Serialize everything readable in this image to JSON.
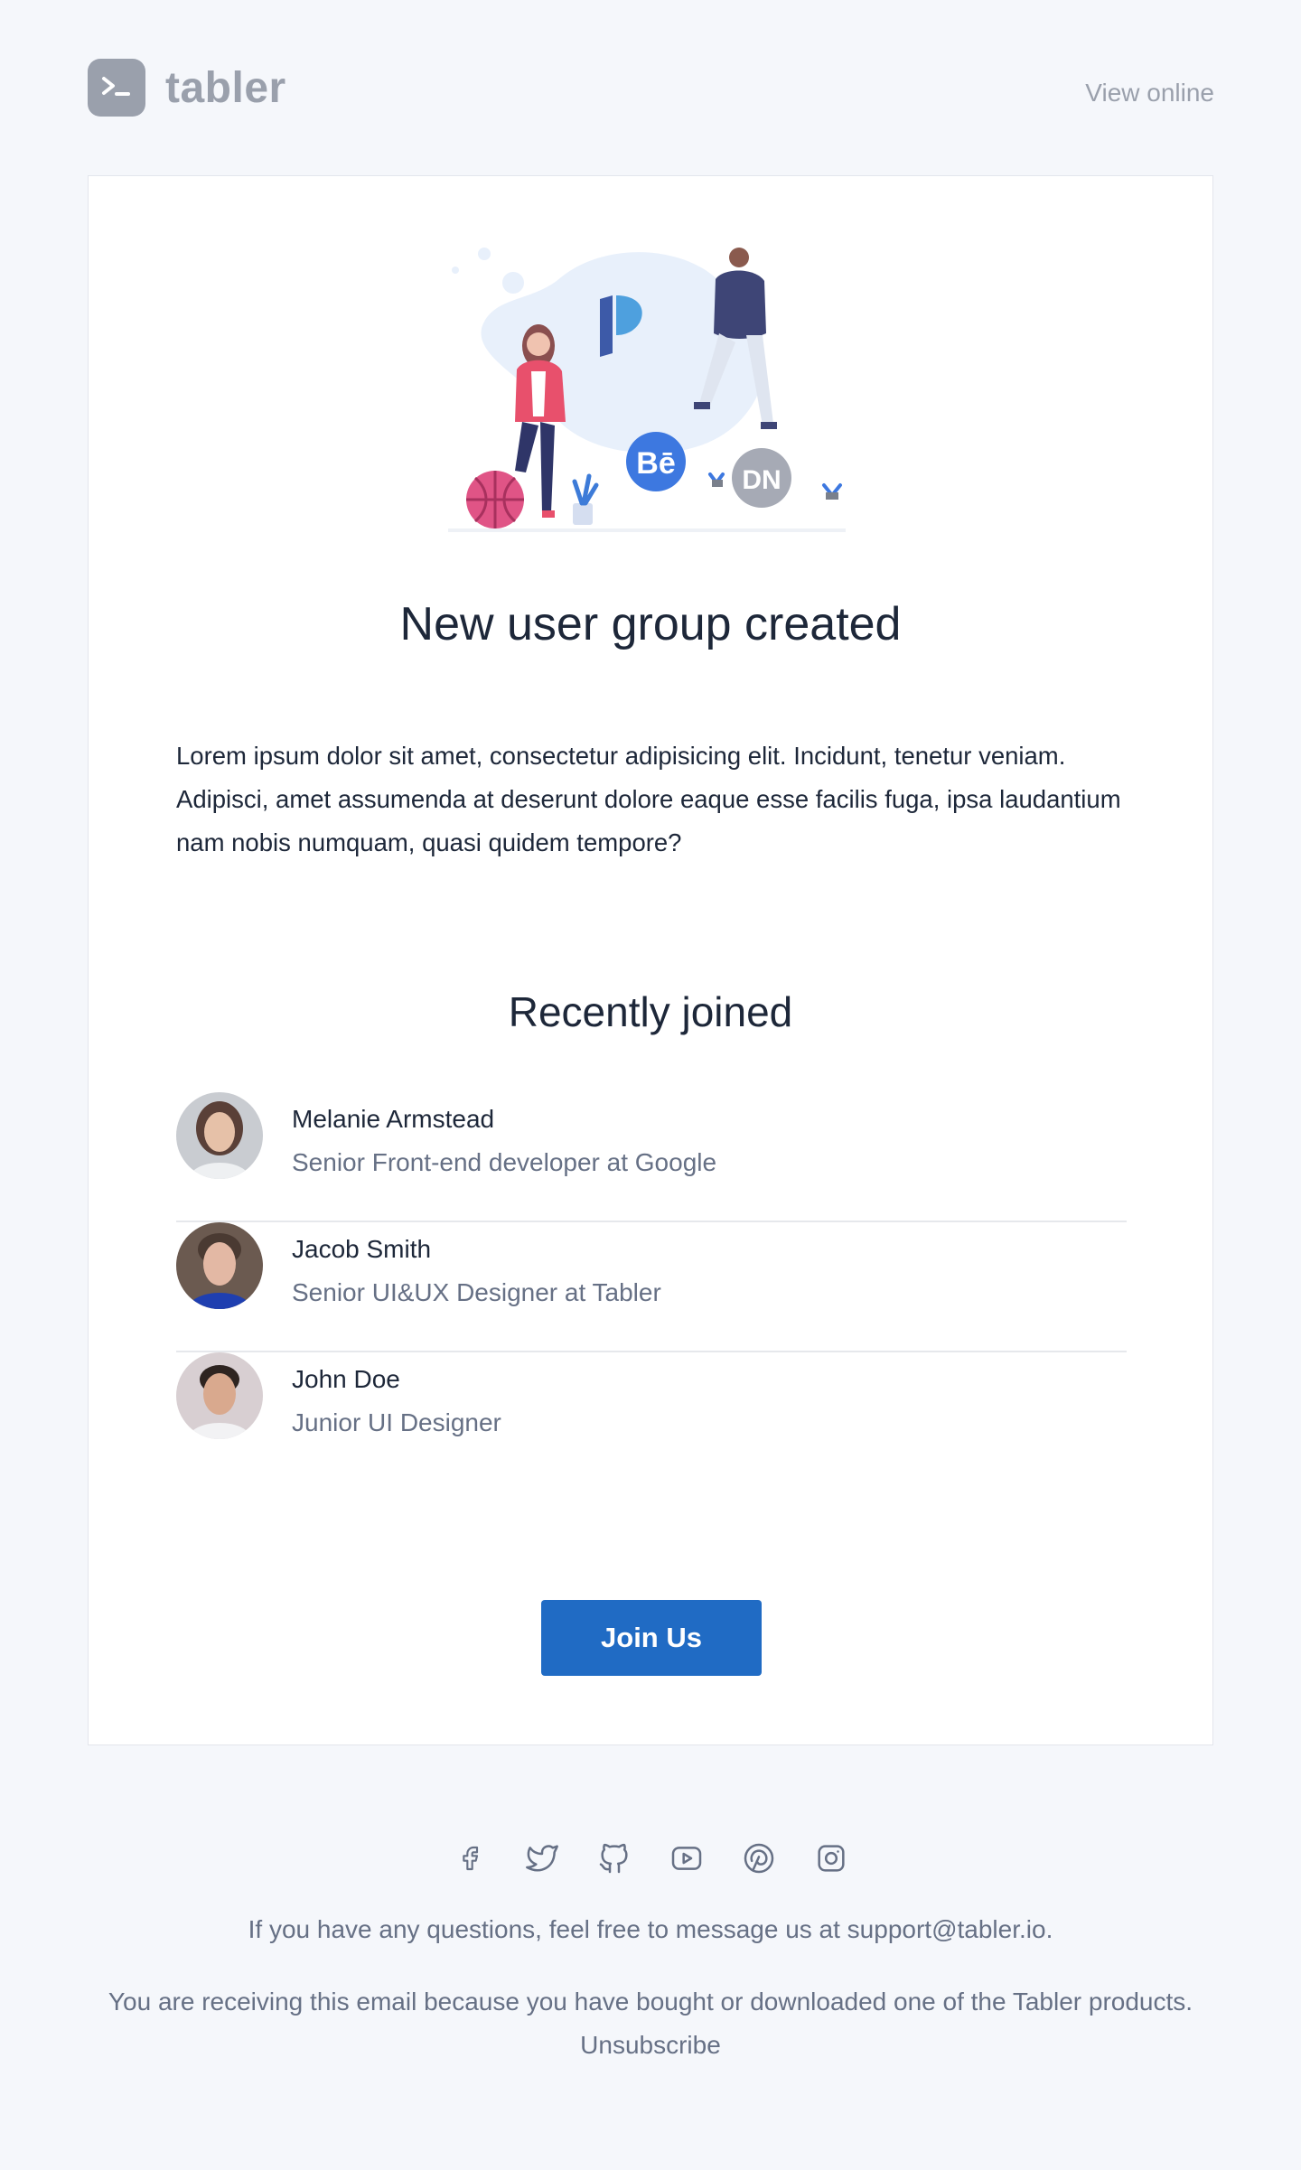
{
  "header": {
    "brand": "tabler",
    "view_online": "View online"
  },
  "card": {
    "title": "New user group created",
    "body": "Lorem ipsum dolor sit amet, consectetur adipisicing elit. Incidunt, tenetur veniam. Adipisci, amet assumenda at deserunt dolore eaque esse facilis fuga, ipsa laudantium nam nobis numquam, quasi quidem tempore?",
    "illustration_badges": [
      "Bē",
      "DN"
    ],
    "recently_joined_title": "Recently joined",
    "members": [
      {
        "name": "Melanie Armstead",
        "role": "Senior Front-end developer at Google"
      },
      {
        "name": "Jacob Smith",
        "role": "Senior UI&UX Designer at Tabler"
      },
      {
        "name": "John Doe",
        "role": "Junior UI Designer"
      }
    ],
    "button_label": "Join Us"
  },
  "footer": {
    "social_icons": [
      "facebook-icon",
      "twitter-icon",
      "github-icon",
      "youtube-icon",
      "pinterest-icon",
      "instagram-icon"
    ],
    "questions": "If you have any questions, feel free to message us at support@tabler.io.",
    "reason": "You are receiving this email because you have bought or downloaded one of the Tabler products.",
    "unsubscribe": "Unsubscribe"
  },
  "colors": {
    "background": "#f5f7fb",
    "primary": "#206bc4",
    "muted": "#9aa0ac"
  }
}
